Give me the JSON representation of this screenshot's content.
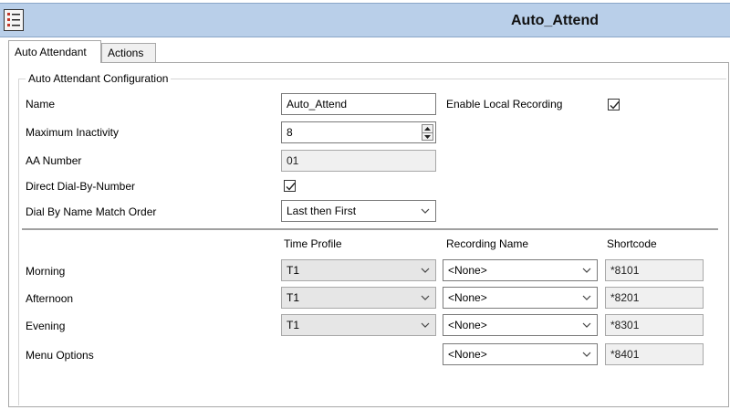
{
  "window": {
    "title": "Auto_Attend"
  },
  "tabs": [
    {
      "label": "Auto Attendant",
      "active": true
    },
    {
      "label": "Actions",
      "active": false
    }
  ],
  "config": {
    "group_label": "Auto Attendant Configuration",
    "name": {
      "label": "Name",
      "value": "Auto_Attend"
    },
    "max_inactivity": {
      "label": "Maximum Inactivity",
      "value": "8"
    },
    "aa_number": {
      "label": "AA Number",
      "value": "01"
    },
    "direct_dial": {
      "label": "Direct Dial-By-Number",
      "checked": true
    },
    "dial_by_name": {
      "label": "Dial By Name Match Order",
      "value": "Last then First"
    },
    "local_recording": {
      "label": "Enable Local Recording",
      "checked": true
    }
  },
  "schedule": {
    "headers": {
      "time_profile": "Time Profile",
      "recording_name": "Recording Name",
      "shortcode": "Shortcode"
    },
    "rows": [
      {
        "label": "Morning",
        "time_profile": "T1",
        "recording": "<None>",
        "shortcode": "*8101"
      },
      {
        "label": "Afternoon",
        "time_profile": "T1",
        "recording": "<None>",
        "shortcode": "*8201"
      },
      {
        "label": "Evening",
        "time_profile": "T1",
        "recording": "<None>",
        "shortcode": "*8301"
      },
      {
        "label": "Menu Options",
        "time_profile": "",
        "recording": "<None>",
        "shortcode": "*8401"
      }
    ]
  },
  "icons": {
    "app": "list-icon",
    "dropdown": "chevron-down-icon",
    "check": "check-icon"
  },
  "colors": {
    "titlebar": "#b9cfe9",
    "disabled": "#e6e6e6"
  }
}
